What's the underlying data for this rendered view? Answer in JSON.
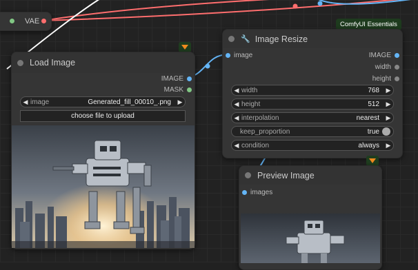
{
  "vae_node": {
    "title": "VAE"
  },
  "badge": {
    "label": "ComfyUI Essentials"
  },
  "load_image": {
    "title": "Load Image",
    "outputs": [
      "IMAGE",
      "MASK"
    ],
    "image_widget": {
      "label": "image",
      "value": "Generated_fill_00010_.png"
    },
    "upload_label": "choose file to upload"
  },
  "image_resize": {
    "title": "Image Resize",
    "input": "image",
    "outputs": [
      "IMAGE",
      "width",
      "height"
    ],
    "widgets": {
      "width": {
        "label": "width",
        "value": "768"
      },
      "height": {
        "label": "height",
        "value": "512"
      },
      "interpolation": {
        "label": "interpolation",
        "value": "nearest"
      },
      "keep_proportion": {
        "label": "keep_proportion",
        "value": "true"
      },
      "condition": {
        "label": "condition",
        "value": "always"
      }
    }
  },
  "preview_image": {
    "title": "Preview Image",
    "input": "images"
  },
  "colors": {
    "canvas": "#222222",
    "node_body": "#353535",
    "link_vae": "#ff6e6e",
    "link_image": "#64b5f6",
    "link_other": "#ffffff",
    "image_dot": "#64b5f6",
    "mask_dot": "#81c784",
    "vae_dot": "#ff6e6e",
    "badge_bg": "#1e3b1e"
  }
}
